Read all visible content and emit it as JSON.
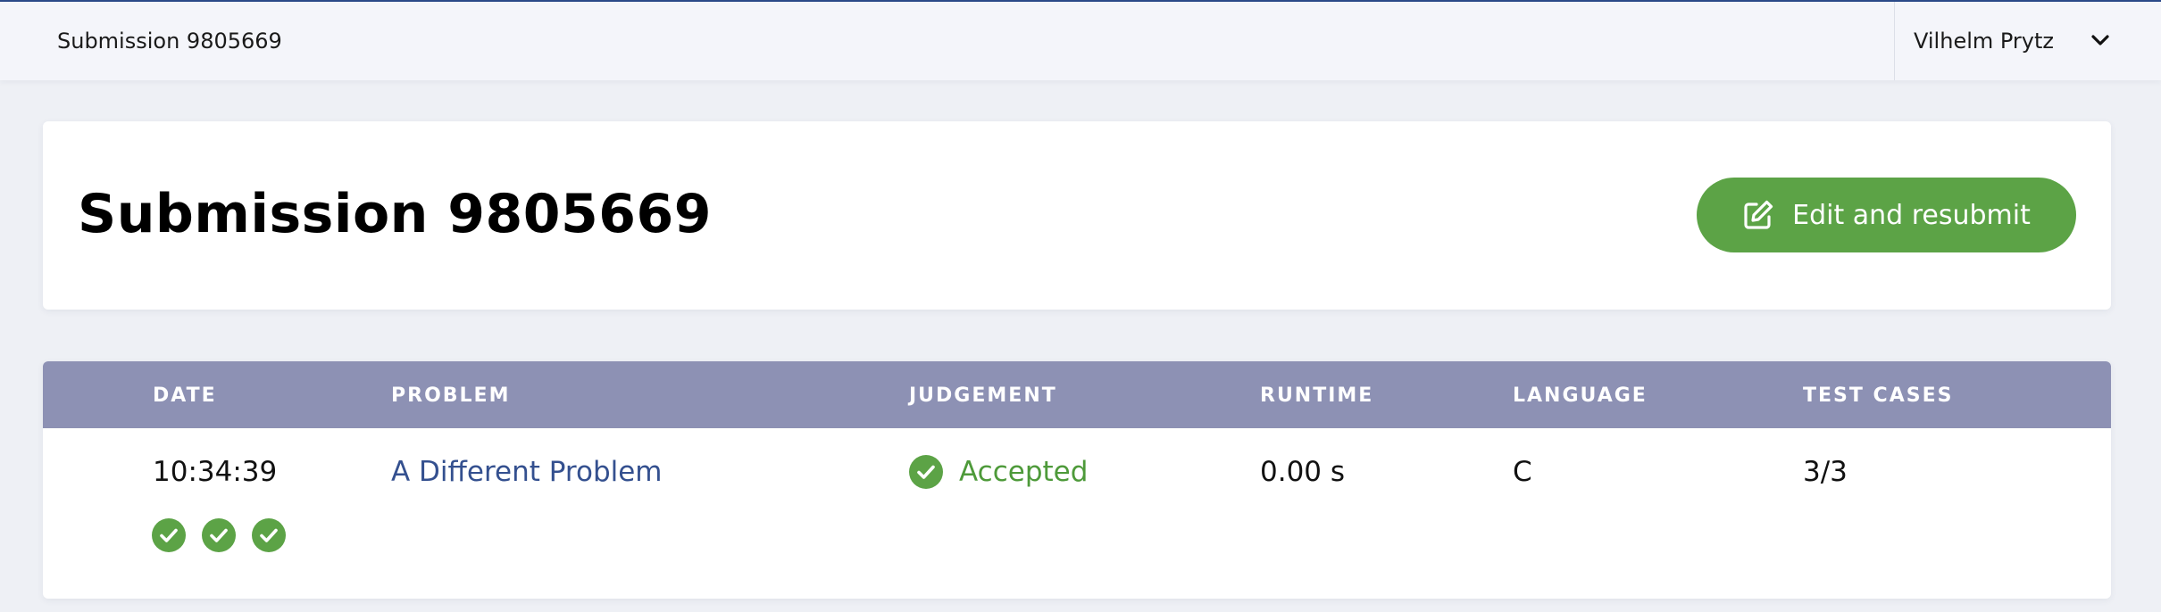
{
  "topbar": {
    "breadcrumb": "Submission 9805669",
    "user": "Vilhelm Prytz"
  },
  "header": {
    "title": "Submission 9805669",
    "resubmit_label": "Edit and resubmit",
    "resubmit_icon": "edit-icon"
  },
  "table": {
    "columns": [
      "DATE",
      "PROBLEM",
      "JUDGEMENT",
      "RUNTIME",
      "LANGUAGE",
      "TEST CASES"
    ],
    "row": {
      "date": "10:34:39",
      "problem": "A Different Problem",
      "judgement": "Accepted",
      "runtime": "0.00 s",
      "language": "C",
      "test_cases": "3/3"
    },
    "test_case_results": [
      "passed",
      "passed",
      "passed"
    ]
  },
  "colors": {
    "accent_green": "#5ca346",
    "header_bar": "#8d91b4",
    "link": "#34508f"
  }
}
